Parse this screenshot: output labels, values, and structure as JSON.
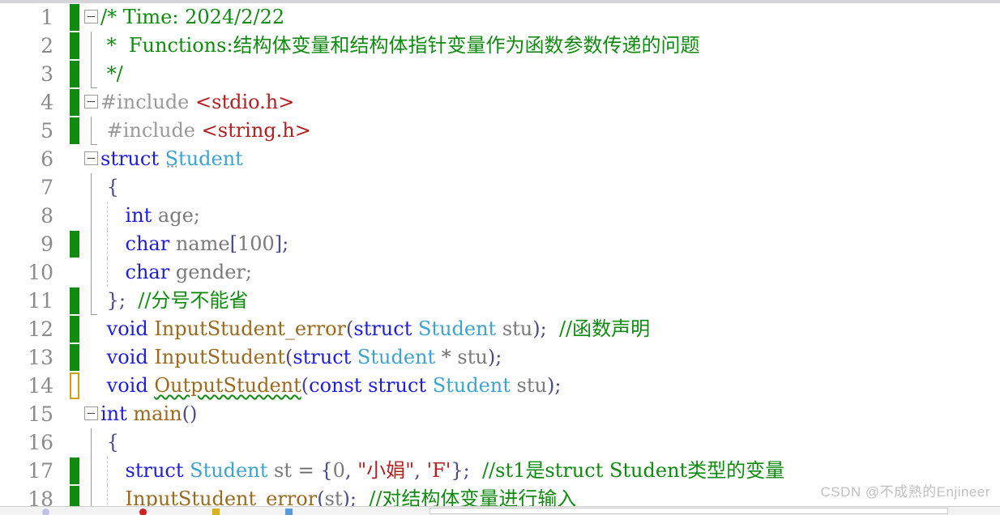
{
  "editor": {
    "app": "visual-studio-code-editor",
    "language": "C",
    "watermark": "CSDN @不成熟的Enjineer",
    "colors": {
      "background": "#ffffff",
      "line_number": "#8a8a8f",
      "comment": "#108a10",
      "keyword": "#1d1ddd",
      "type": "#3fa3cf",
      "function": "#9a6a20",
      "string": "#b41f1f",
      "preprocessor": "#9a9a9a",
      "change_marker_saved": "#108a10",
      "change_marker_unsaved": "#c8a317",
      "error_squiggle": "#108a10"
    }
  },
  "lines": [
    {
      "number": "1",
      "change": "green",
      "fold": "collapse",
      "indent": 0,
      "tokens": [
        {
          "text": "/* Time: 2024/2/22",
          "cls": "t-comment"
        }
      ]
    },
    {
      "number": "2",
      "change": "green",
      "fold": "rail",
      "indent": 0,
      "tokens": [
        {
          "text": " *  Functions:结构体变量和结构体指针变量作为函数参数传递的问题",
          "cls": "t-comment"
        }
      ]
    },
    {
      "number": "3",
      "change": "green",
      "fold": "rail-end",
      "indent": 0,
      "tokens": [
        {
          "text": " */",
          "cls": "t-comment"
        }
      ]
    },
    {
      "number": "4",
      "change": "green",
      "fold": "collapse",
      "indent": 0,
      "tokens": [
        {
          "text": "#include ",
          "cls": "t-preproc"
        },
        {
          "text": "<stdio.h>",
          "cls": "t-string"
        }
      ]
    },
    {
      "number": "5",
      "change": "green",
      "fold": "rail-end",
      "indent": 0,
      "tokens": [
        {
          "text": " #include ",
          "cls": "t-preproc"
        },
        {
          "text": "<string.h>",
          "cls": "t-string"
        }
      ]
    },
    {
      "number": "6",
      "change": "none",
      "fold": "collapse",
      "indent": 0,
      "tokens": [
        {
          "text": "struct ",
          "cls": "t-keyword"
        },
        {
          "text": "Student",
          "cls": "t-type",
          "deco": "smarttag"
        }
      ]
    },
    {
      "number": "7",
      "change": "none",
      "fold": "rail",
      "indent": 0,
      "tokens": [
        {
          "text": " {",
          "cls": "t-punct"
        }
      ]
    },
    {
      "number": "8",
      "change": "none",
      "fold": "rail",
      "indent": 1,
      "tokens": [
        {
          "text": "    int ",
          "cls": "t-keyword"
        },
        {
          "text": "age;",
          "cls": "t-plain"
        }
      ]
    },
    {
      "number": "9",
      "change": "green",
      "fold": "rail",
      "indent": 1,
      "tokens": [
        {
          "text": "    char ",
          "cls": "t-keyword"
        },
        {
          "text": "name",
          "cls": "t-plain"
        },
        {
          "text": "[",
          "cls": "t-punct"
        },
        {
          "text": "100",
          "cls": "t-num"
        },
        {
          "text": "];",
          "cls": "t-punct"
        }
      ]
    },
    {
      "number": "10",
      "change": "none",
      "fold": "rail",
      "indent": 1,
      "tokens": [
        {
          "text": "    char ",
          "cls": "t-keyword"
        },
        {
          "text": "gender;",
          "cls": "t-plain"
        }
      ]
    },
    {
      "number": "11",
      "change": "green",
      "fold": "rail-end",
      "indent": 0,
      "tokens": [
        {
          "text": " };",
          "cls": "t-punct"
        },
        {
          "text": "  //分号不能省",
          "cls": "t-comment"
        }
      ]
    },
    {
      "number": "12",
      "change": "green",
      "fold": "none",
      "indent": 0,
      "tokens": [
        {
          "text": " void ",
          "cls": "t-keyword"
        },
        {
          "text": "InputStudent_error",
          "cls": "t-func"
        },
        {
          "text": "(",
          "cls": "t-punct"
        },
        {
          "text": "struct ",
          "cls": "t-keyword"
        },
        {
          "text": "Student ",
          "cls": "t-type"
        },
        {
          "text": "stu",
          "cls": "t-plain"
        },
        {
          "text": ");",
          "cls": "t-punct"
        },
        {
          "text": "  //函数声明",
          "cls": "t-comment"
        }
      ]
    },
    {
      "number": "13",
      "change": "green",
      "fold": "none",
      "indent": 0,
      "tokens": [
        {
          "text": " void ",
          "cls": "t-keyword"
        },
        {
          "text": "InputStudent",
          "cls": "t-func"
        },
        {
          "text": "(",
          "cls": "t-punct"
        },
        {
          "text": "struct ",
          "cls": "t-keyword"
        },
        {
          "text": "Student ",
          "cls": "t-type"
        },
        {
          "text": "* ",
          "cls": "t-op"
        },
        {
          "text": "stu",
          "cls": "t-plain"
        },
        {
          "text": ");",
          "cls": "t-punct"
        }
      ]
    },
    {
      "number": "14",
      "change": "yellow",
      "fold": "none",
      "indent": 0,
      "tokens": [
        {
          "text": " void ",
          "cls": "t-keyword"
        },
        {
          "text": "OutputStudent",
          "cls": "t-func",
          "deco": "squiggle"
        },
        {
          "text": "(",
          "cls": "t-punct"
        },
        {
          "text": "const struct ",
          "cls": "t-keyword"
        },
        {
          "text": "Student ",
          "cls": "t-type"
        },
        {
          "text": "stu",
          "cls": "t-plain"
        },
        {
          "text": ");",
          "cls": "t-punct"
        }
      ]
    },
    {
      "number": "15",
      "change": "none",
      "fold": "collapse",
      "indent": 0,
      "tokens": [
        {
          "text": "int ",
          "cls": "t-keyword"
        },
        {
          "text": "main",
          "cls": "t-func"
        },
        {
          "text": "()",
          "cls": "t-punct"
        }
      ]
    },
    {
      "number": "16",
      "change": "none",
      "fold": "rail",
      "indent": 0,
      "tokens": [
        {
          "text": " {",
          "cls": "t-punct"
        }
      ]
    },
    {
      "number": "17",
      "change": "green",
      "fold": "rail",
      "indent": 1,
      "tokens": [
        {
          "text": "    struct ",
          "cls": "t-keyword"
        },
        {
          "text": "Student ",
          "cls": "t-type"
        },
        {
          "text": "st ",
          "cls": "t-plain"
        },
        {
          "text": "= ",
          "cls": "t-op"
        },
        {
          "text": "{",
          "cls": "t-punct"
        },
        {
          "text": "0",
          "cls": "t-num"
        },
        {
          "text": ", ",
          "cls": "t-punct"
        },
        {
          "text": "\"小娟\"",
          "cls": "t-string"
        },
        {
          "text": ", ",
          "cls": "t-punct"
        },
        {
          "text": "'F'",
          "cls": "t-string"
        },
        {
          "text": "};",
          "cls": "t-punct"
        },
        {
          "text": "  //st1是struct Student类型的变量",
          "cls": "t-comment"
        }
      ]
    },
    {
      "number": "18",
      "change": "green",
      "fold": "rail",
      "indent": 1,
      "tokens": [
        {
          "text": "    InputStudent_error",
          "cls": "t-func"
        },
        {
          "text": "(",
          "cls": "t-punct"
        },
        {
          "text": "st",
          "cls": "t-plain"
        },
        {
          "text": ");",
          "cls": "t-punct"
        },
        {
          "text": "  //对结构体变量进行输入",
          "cls": "t-comment"
        }
      ]
    }
  ]
}
